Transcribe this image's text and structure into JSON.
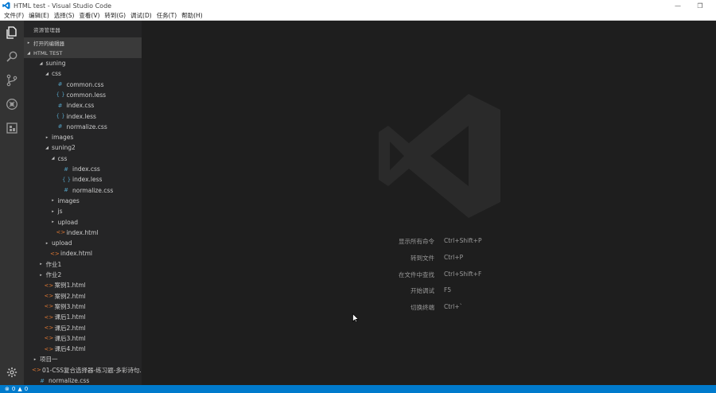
{
  "window": {
    "title": "HTML test - Visual Studio Code",
    "minimize": "—",
    "restore": "❐"
  },
  "menu": [
    "文件(F)",
    "编辑(E)",
    "选择(S)",
    "查看(V)",
    "转到(G)",
    "调试(D)",
    "任务(T)",
    "帮助(H)"
  ],
  "activity": {
    "icons": [
      "explorer-icon",
      "search-icon",
      "source-control-icon",
      "debug-icon",
      "extensions-icon",
      "gear-icon"
    ]
  },
  "sidebar": {
    "title": "资源管理器",
    "open_editors": "打开的编辑器",
    "project": "HTML TEST",
    "tree": [
      {
        "label": "suning",
        "type": "folder",
        "open": true,
        "depth": 1
      },
      {
        "label": "css",
        "type": "folder",
        "open": true,
        "depth": 2
      },
      {
        "label": "common.css",
        "type": "css",
        "depth": 3
      },
      {
        "label": "common.less",
        "type": "less",
        "depth": 3
      },
      {
        "label": "index.css",
        "type": "css",
        "depth": 3
      },
      {
        "label": "index.less",
        "type": "less",
        "depth": 3
      },
      {
        "label": "normalize.css",
        "type": "css",
        "depth": 3
      },
      {
        "label": "images",
        "type": "folder",
        "open": false,
        "depth": 2
      },
      {
        "label": "suning2",
        "type": "folder",
        "open": true,
        "depth": 2
      },
      {
        "label": "css",
        "type": "folder",
        "open": true,
        "depth": 3
      },
      {
        "label": "index.css",
        "type": "css",
        "depth": 4
      },
      {
        "label": "index.less",
        "type": "less",
        "depth": 4
      },
      {
        "label": "normalize.css",
        "type": "css",
        "depth": 4
      },
      {
        "label": "images",
        "type": "folder",
        "open": false,
        "depth": 3
      },
      {
        "label": "js",
        "type": "folder",
        "open": false,
        "depth": 3
      },
      {
        "label": "upload",
        "type": "folder",
        "open": false,
        "depth": 3
      },
      {
        "label": "index.html",
        "type": "html",
        "depth": 3
      },
      {
        "label": "upload",
        "type": "folder",
        "open": false,
        "depth": 2
      },
      {
        "label": "index.html",
        "type": "html",
        "depth": 2
      },
      {
        "label": "作业1",
        "type": "folder",
        "open": false,
        "depth": 1
      },
      {
        "label": "作业2",
        "type": "folder",
        "open": false,
        "depth": 1
      },
      {
        "label": "案例1.html",
        "type": "html",
        "depth": 1
      },
      {
        "label": "案例2.html",
        "type": "html",
        "depth": 1
      },
      {
        "label": "案例3.html",
        "type": "html",
        "depth": 1
      },
      {
        "label": "课后1.html",
        "type": "html",
        "depth": 1
      },
      {
        "label": "课后2.html",
        "type": "html",
        "depth": 1
      },
      {
        "label": "课后3.html",
        "type": "html",
        "depth": 1
      },
      {
        "label": "课后4.html",
        "type": "html",
        "depth": 1
      },
      {
        "label": "项目一",
        "type": "folder",
        "open": false,
        "depth": 0
      },
      {
        "label": "01-CSS复合选择器-练习题-多彩诗句...",
        "type": "html",
        "depth": 0
      },
      {
        "label": "normalize.css",
        "type": "css",
        "depth": 0
      }
    ]
  },
  "shortcuts": [
    {
      "label": "显示所有命令",
      "key": "Ctrl+Shift+P"
    },
    {
      "label": "转到文件",
      "key": "Ctrl+P"
    },
    {
      "label": "在文件中查找",
      "key": "Ctrl+Shift+F"
    },
    {
      "label": "开始调试",
      "key": "F5"
    },
    {
      "label": "切换终端",
      "key": "Ctrl+`"
    }
  ],
  "status": {
    "errors": "0",
    "warnings": "0"
  },
  "colors": {
    "activitybar": "#333333",
    "sidebar": "#252526",
    "editor": "#1e1e1e",
    "statusbar": "#007acc"
  }
}
